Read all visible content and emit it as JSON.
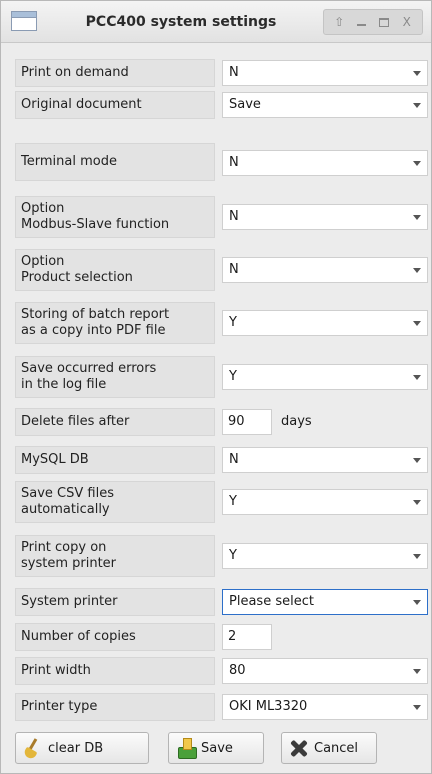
{
  "window": {
    "title": "PCC400 system settings",
    "buttons": {
      "up": "⇧",
      "minimize": "_",
      "maximize": "□",
      "close": "X"
    }
  },
  "settings": {
    "print_on_demand": {
      "label": [
        "Print on demand"
      ],
      "value": "N"
    },
    "original_document": {
      "label": [
        "Original document"
      ],
      "value": "Save"
    },
    "terminal_mode": {
      "label": [
        "Terminal mode"
      ],
      "value": "N"
    },
    "modbus_slave": {
      "label": [
        "Option",
        "Modbus-Slave function"
      ],
      "value": "N"
    },
    "product_selection": {
      "label": [
        "Option",
        "Product selection"
      ],
      "value": "N"
    },
    "batch_report_pdf": {
      "label": [
        "Storing of batch report",
        "as a copy into PDF file"
      ],
      "value": "Y"
    },
    "save_errors_log": {
      "label": [
        "Save occurred errors",
        "in the log file"
      ],
      "value": "Y"
    },
    "delete_files_after": {
      "label": [
        "Delete files after"
      ],
      "value": "90",
      "unit": "days"
    },
    "mysql_db": {
      "label": [
        "MySQL DB"
      ],
      "value": "N"
    },
    "save_csv": {
      "label": [
        "Save CSV files",
        "automatically"
      ],
      "value": "Y"
    },
    "print_copy_system": {
      "label": [
        "Print copy on",
        "system printer"
      ],
      "value": "Y"
    },
    "system_printer": {
      "label": [
        "System printer"
      ],
      "value": "Please select"
    },
    "number_of_copies": {
      "label": [
        "Number of copies"
      ],
      "value": "2"
    },
    "print_width": {
      "label": [
        "Print width"
      ],
      "value": "80"
    },
    "printer_type": {
      "label": [
        "Printer type"
      ],
      "value": "OKI ML3320"
    }
  },
  "actions": {
    "clear_db": {
      "label": "clear DB",
      "icon": "broom-icon"
    },
    "save": {
      "label": "Save",
      "icon": "save-icon"
    },
    "cancel": {
      "label": "Cancel",
      "icon": "cancel-icon"
    }
  }
}
